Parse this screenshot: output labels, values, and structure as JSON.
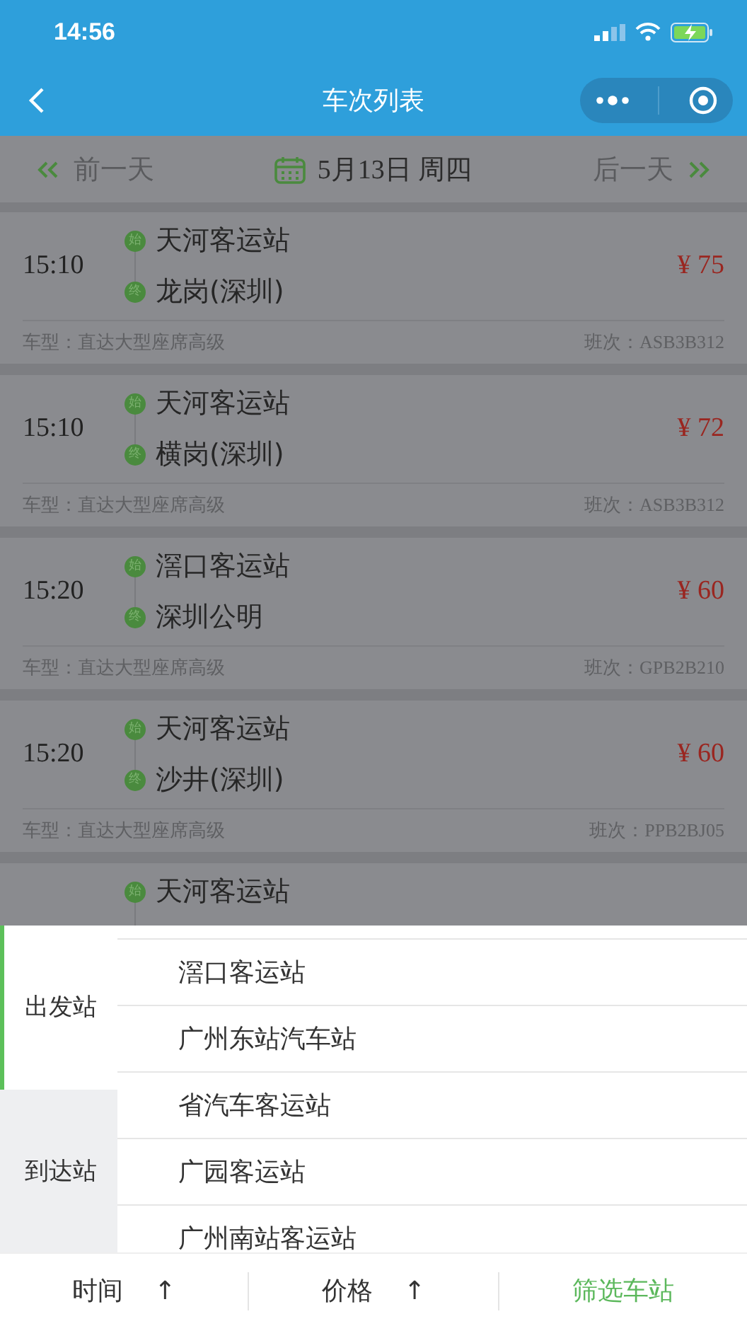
{
  "status_bar": {
    "time": "14:56"
  },
  "nav": {
    "title": "车次列表"
  },
  "date_bar": {
    "prev": "前一天",
    "date": "5月13日 周四",
    "next": "后一天"
  },
  "trips": [
    {
      "time": "15:10",
      "from_badge": "始",
      "from": "天河客运站",
      "to_badge": "终",
      "to": "龙岗(深圳)",
      "price": "¥ 75",
      "vehicle_type": "车型：直达大型座席高级",
      "trip_no": "班次：ASB3B312"
    },
    {
      "time": "15:10",
      "from_badge": "始",
      "from": "天河客运站",
      "to_badge": "终",
      "to": "横岗(深圳)",
      "price": "¥ 72",
      "vehicle_type": "车型：直达大型座席高级",
      "trip_no": "班次：ASB3B312"
    },
    {
      "time": "15:20",
      "from_badge": "始",
      "from": "滘口客运站",
      "to_badge": "终",
      "to": "深圳公明",
      "price": "¥ 60",
      "vehicle_type": "车型：直达大型座席高级",
      "trip_no": "班次：GPB2B210"
    },
    {
      "time": "15:20",
      "from_badge": "始",
      "from": "天河客运站",
      "to_badge": "终",
      "to": "沙井(深圳)",
      "price": "¥ 60",
      "vehicle_type": "车型：直达大型座席高级",
      "trip_no": "班次：PPB2BJ05"
    },
    {
      "from_badge": "始",
      "from": "天河客运站"
    }
  ],
  "station_filter": {
    "tabs": [
      {
        "label": "出发站",
        "selected": true
      },
      {
        "label": "到达站",
        "selected": false
      }
    ],
    "stations": [
      "滘口客运站",
      "广州东站汽车站",
      "省汽车客运站",
      "广园客运站",
      "广州南站客运站"
    ]
  },
  "sort_bar": [
    {
      "kind": "sort",
      "label": "时间",
      "arrow": "↑"
    },
    {
      "kind": "sort",
      "label": "价格",
      "arrow": "↑"
    },
    {
      "kind": "filter",
      "label": "筛选车站"
    }
  ]
}
